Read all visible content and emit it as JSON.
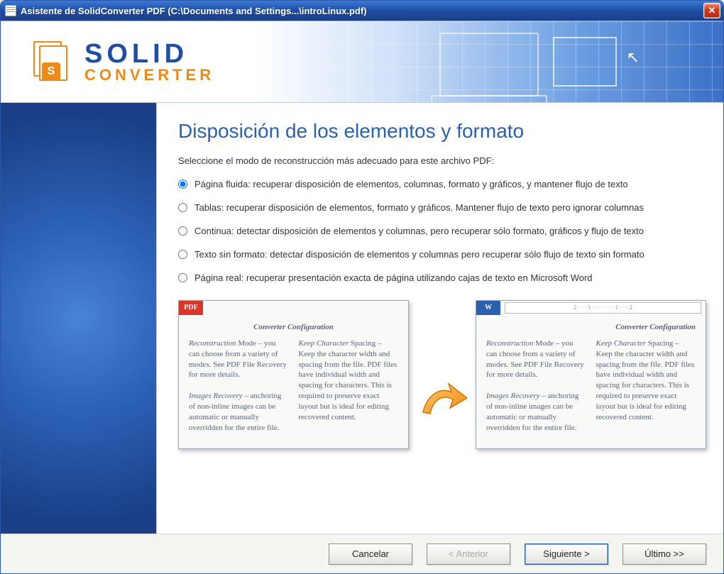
{
  "window": {
    "title": "Asistente de SolidConverter PDF (C:\\Documents and Settings...\\introLinux.pdf)"
  },
  "logo": {
    "line1": "SOLID",
    "line2": "CONVERTER",
    "badge": "S"
  },
  "main": {
    "heading": "Disposición de los elementos y formato",
    "instructions": "Seleccione el modo de reconstrucción más adecuado para este archivo PDF:",
    "options": [
      {
        "label": "Página fluida: recuperar disposición de elementos, columnas, formato y gráficos, y mantener flujo de texto",
        "checked": true
      },
      {
        "label": "Tablas: recuperar disposición de elementos, formato y gráficos. Mantener flujo de texto pero ignorar columnas",
        "checked": false
      },
      {
        "label": "Continua: detectar disposición de elementos y columnas, pero recuperar sólo formato, gráficos y flujo de texto",
        "checked": false
      },
      {
        "label": "Texto sin formato: detectar disposición de elementos y columnas pero recuperar sólo flujo de texto sin formato",
        "checked": false
      },
      {
        "label": "Página real: recuperar presentación exacta de página utilizando cajas de texto en Microsoft Word",
        "checked": false
      }
    ]
  },
  "preview": {
    "pdf_tag": "PDF",
    "word_tag": "W",
    "doc_title": "Converter Configuration",
    "col1_title": "Reconstruction",
    "col1_body": "Mode – you can choose from a variety of modes. See PDF File Recovery for more details.",
    "col1b_title": "Images Recovery",
    "col1b_body": "– anchoring of non-inline images can be automatic or manually overridden for the entire file.",
    "col2_title": "Keep Character",
    "col2_body": "Spacing – Keep the character width and spacing from the file. PDF files have individual width and spacing for characters. This is required to preserve exact layout but is ideal for editing recovered content.",
    "ruler": "2 · · · 1 · · · · · · · 1 · · · 2"
  },
  "buttons": {
    "cancel": "Cancelar",
    "back": "< Anterior",
    "next": "Siguiente >",
    "last": "Último >>"
  }
}
